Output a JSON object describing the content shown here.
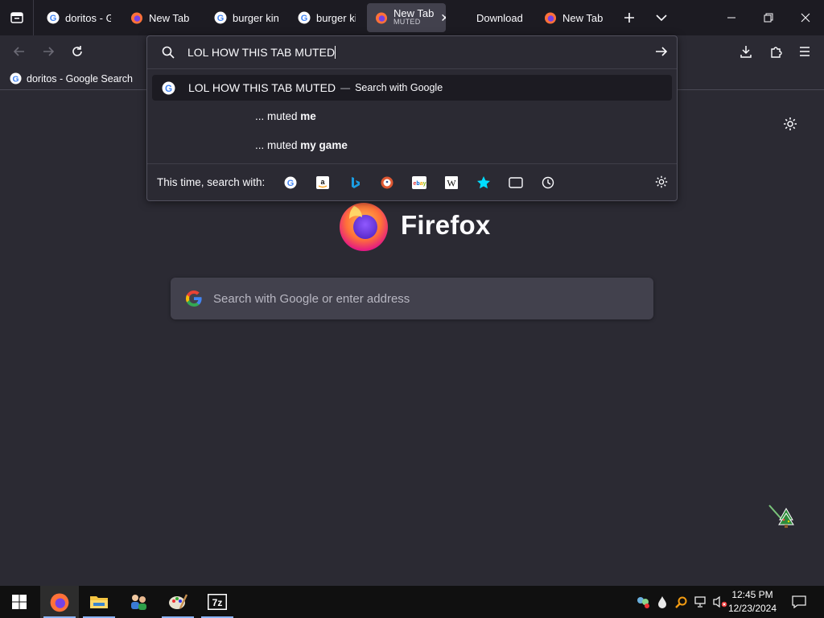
{
  "tabs": [
    {
      "label": "doritos - G",
      "icon": "google-icon"
    },
    {
      "label": "New Tab",
      "icon": "firefox-icon"
    },
    {
      "label": "burger king",
      "icon": "google-icon"
    },
    {
      "label": "burger king",
      "icon": "google-icon"
    },
    {
      "label": "New Tab",
      "sublabel": "MUTED",
      "icon": "firefox-icon",
      "active": true
    },
    {
      "label": "Download",
      "icon": "none"
    },
    {
      "label": "New Tab",
      "icon": "firefox-icon"
    }
  ],
  "bookmarks": [
    {
      "label": "doritos - Google Search"
    }
  ],
  "urlbar": {
    "value": "LOL HOW THIS TAB MUTED",
    "results": {
      "main": {
        "text": "LOL HOW THIS TAB MUTED",
        "separator": "—",
        "action": "Search with Google"
      },
      "suggestions": [
        {
          "prefix": "... muted",
          "bold": "me"
        },
        {
          "prefix": "... muted",
          "bold": "my game"
        }
      ]
    },
    "oneoff_label": "This time, search with:",
    "engines": [
      "google-icon",
      "amazon-icon",
      "bing-icon",
      "duckduckgo-icon",
      "ebay-icon",
      "wikipedia-icon",
      "bookmarks-star-icon",
      "tabs-icon",
      "history-clock-icon"
    ]
  },
  "page": {
    "brand": "Firefox",
    "search_placeholder": "Search with Google or enter address"
  },
  "taskbar": {
    "apps": [
      "start-icon",
      "firefox-icon",
      "file-explorer-icon",
      "users-icon",
      "paint-icon",
      "7zip-icon"
    ],
    "time": "12:45 PM",
    "date": "12/23/2024"
  },
  "colors": {
    "tabstrip": "#1c1b22",
    "toolbar": "#2b2a33",
    "active_tab": "#42414d",
    "taskbar": "#101010"
  }
}
